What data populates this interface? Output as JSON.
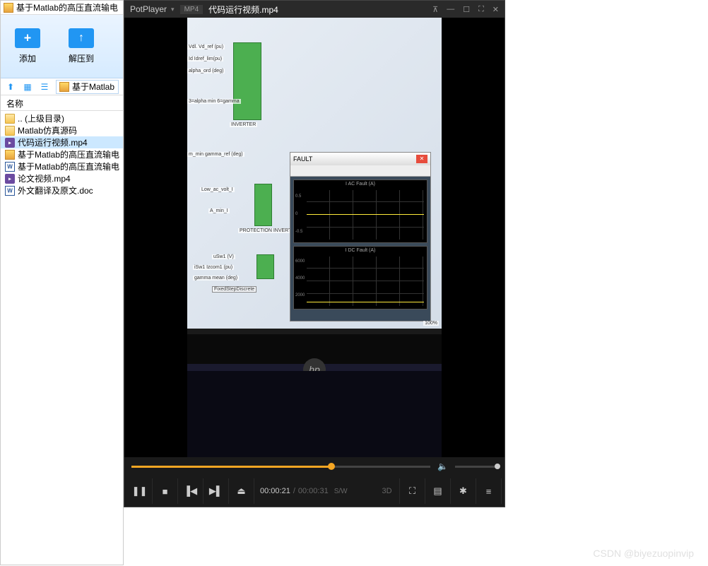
{
  "file_manager": {
    "title": "基于Matlab的高压直流输电",
    "toolbar": {
      "add": "添加",
      "extract": "解压到"
    },
    "path": "基于Matlab",
    "header": "名称",
    "items": [
      {
        "name": ".. (上级目录)",
        "type": "folder"
      },
      {
        "name": "Matlab仿真源码",
        "type": "folder"
      },
      {
        "name": "代码运行视频.mp4",
        "type": "mp4",
        "selected": true
      },
      {
        "name": "基于Matlab的高压直流输电",
        "type": "pdf"
      },
      {
        "name": "基于Matlab的高压直流输电",
        "type": "doc"
      },
      {
        "name": "论文视频.mp4",
        "type": "mp4"
      },
      {
        "name": "外文翻译及原文.doc",
        "type": "doc"
      }
    ]
  },
  "potplayer": {
    "app": "PotPlayer",
    "format": "MP4",
    "filename": "代码运行视频.mp4",
    "time_current": "00:00:21",
    "time_total": "00:00:31",
    "mode": "S/W",
    "btn_3d": "3D",
    "sim": {
      "inverter": "INVERTER",
      "protection": "PROTECTION INVERTER",
      "fixed": "FixedStepDiscrete",
      "labels": [
        "Vdl. Vd_ref (pu)",
        "Id Idref_lim(pu)",
        "alpha_ord (deg)",
        "3=alpha min 6=gamma",
        "m_min gamma_ref (deg)",
        "Low_ac_volt_I",
        "A_min_I",
        "uSw1 (V)",
        "iSw1 Izcom1 (pu)",
        "gamma mean (deg)"
      ]
    },
    "fault": {
      "title": "FAULT",
      "scope1": {
        "title": "I AC Fault (A)",
        "yticks": [
          "0.5",
          "0",
          "-0.5"
        ]
      },
      "scope2": {
        "title": "I DC Fault (A)",
        "yticks": [
          "6000",
          "4000",
          "2000"
        ]
      },
      "zoom": "100%"
    },
    "hp": "hp"
  },
  "watermark": "CSDN @biyezuopinvip"
}
